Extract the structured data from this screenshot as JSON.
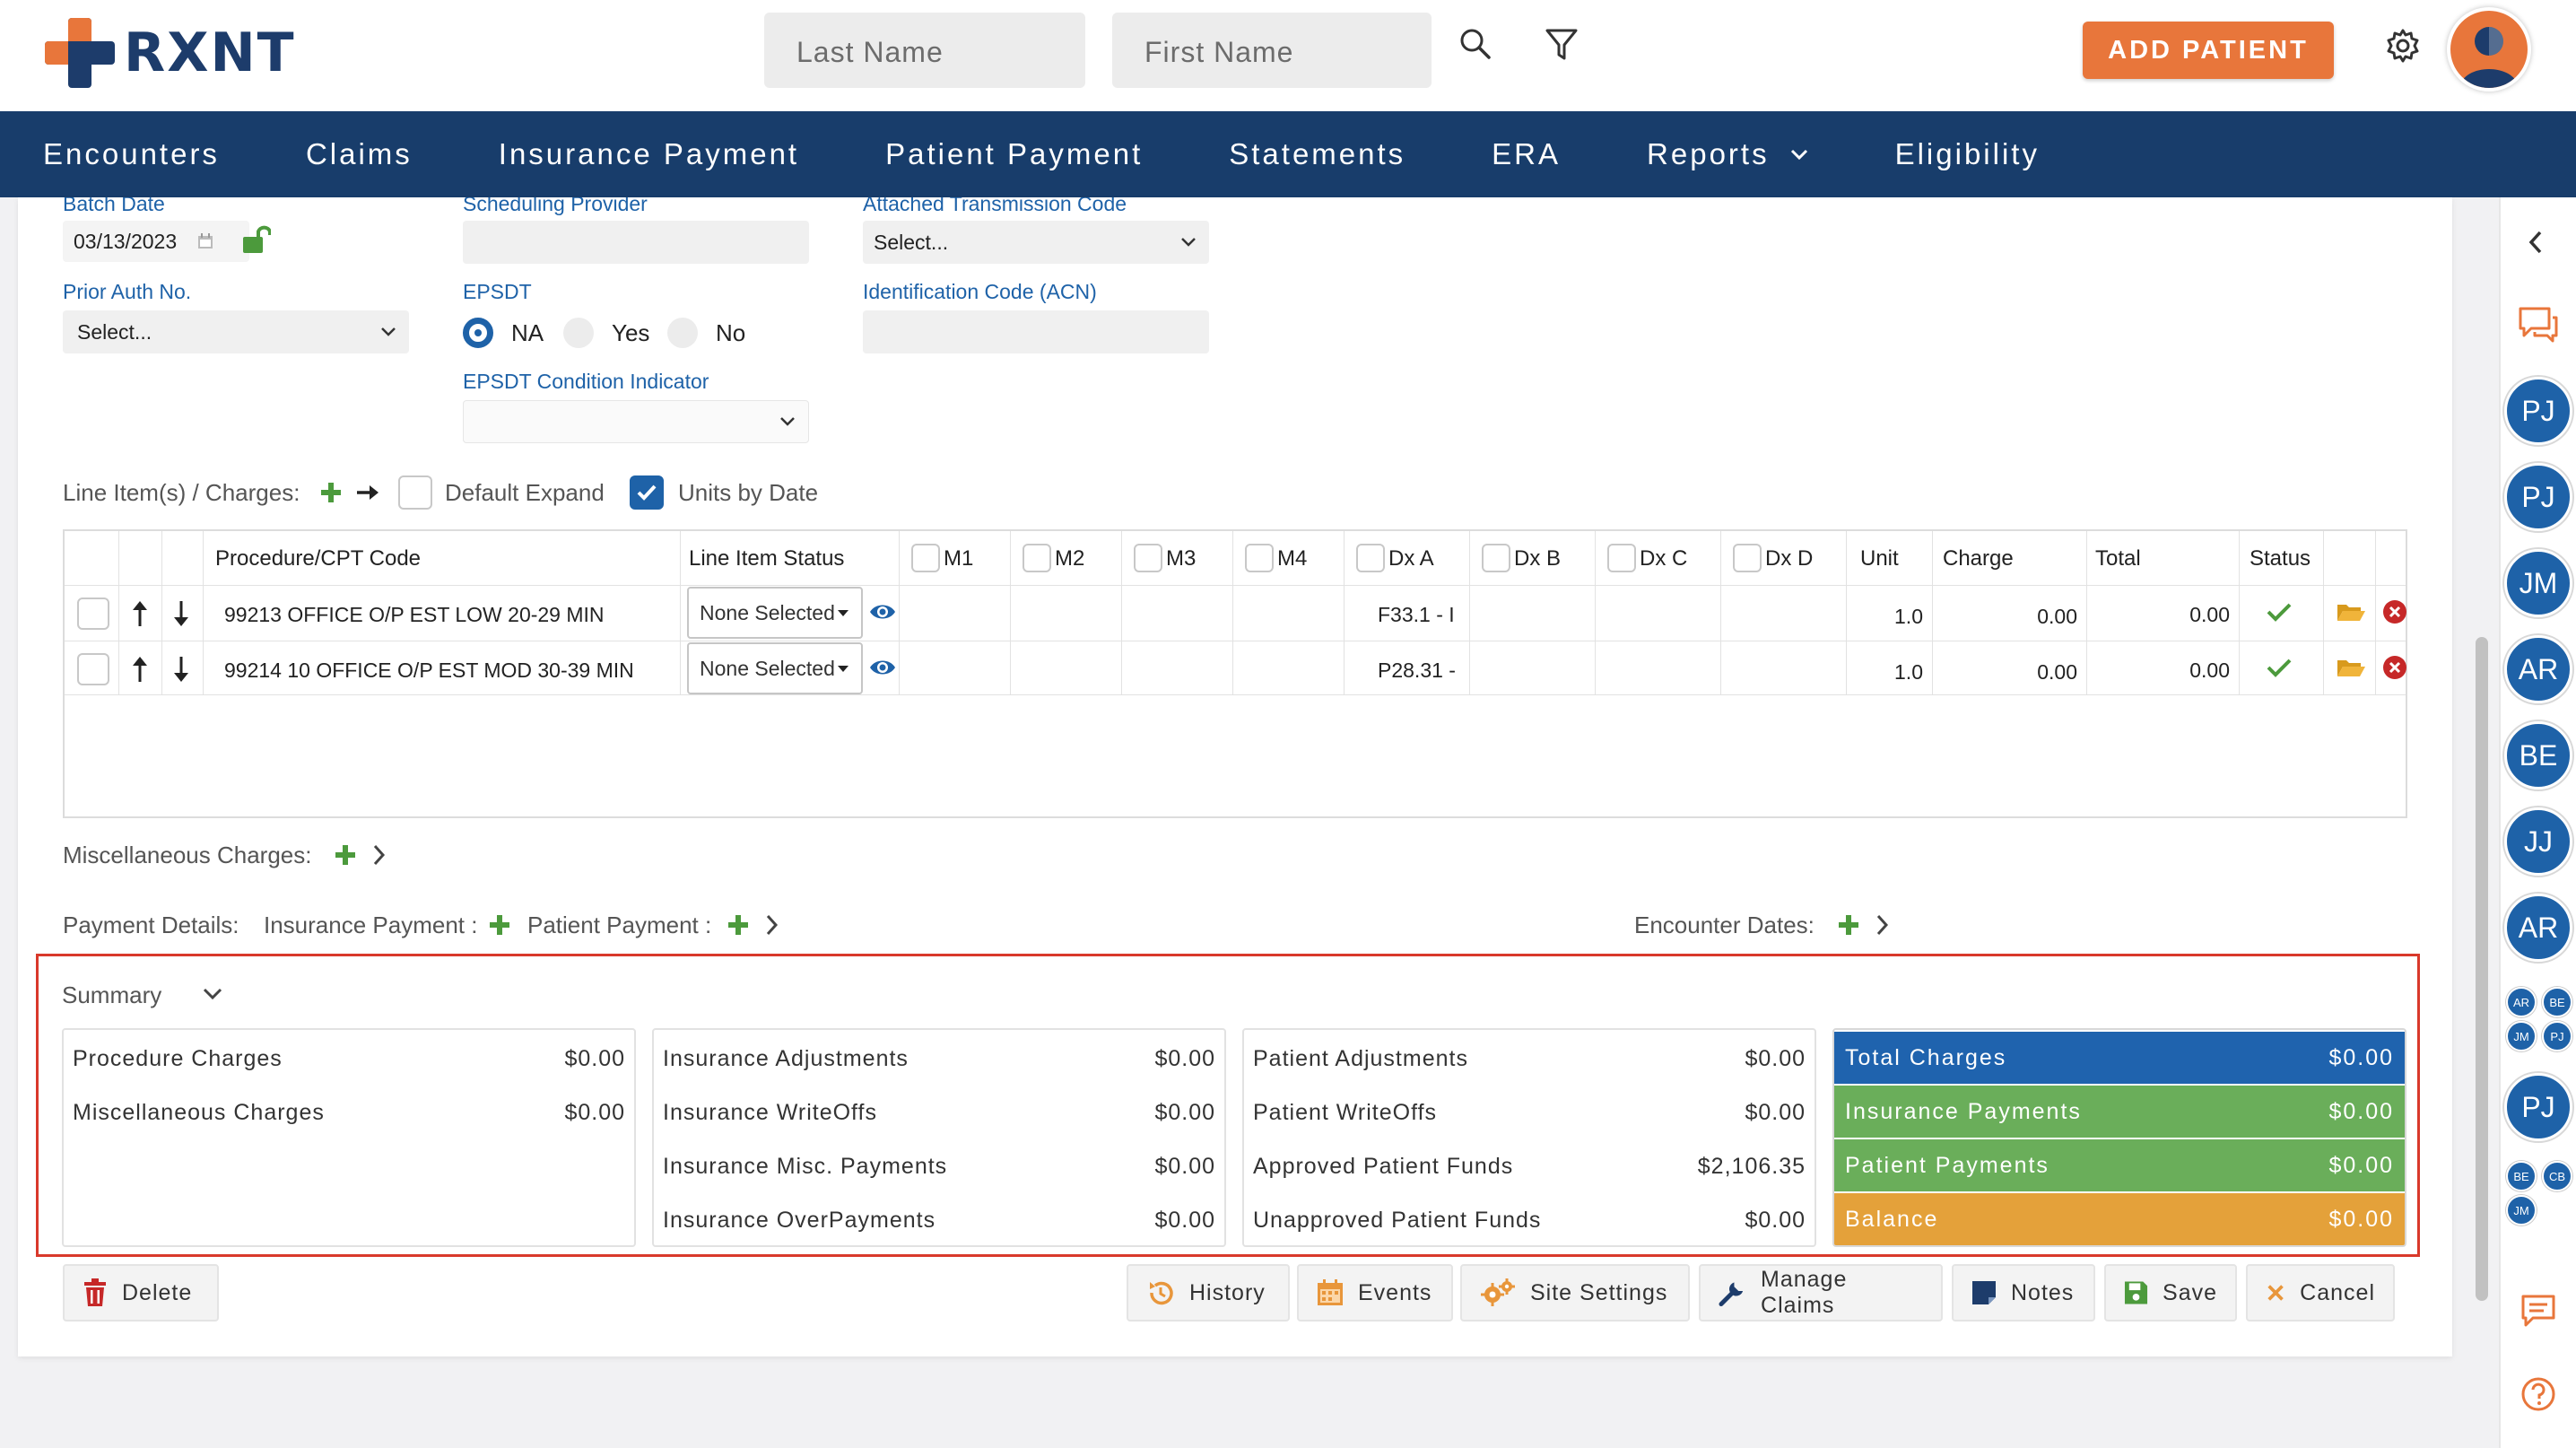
{
  "brand": {
    "name": "RXNT"
  },
  "search": {
    "last_name_placeholder": "Last Name",
    "first_name_placeholder": "First Name"
  },
  "header": {
    "add_patient_label": "ADD PATIENT"
  },
  "nav": {
    "items": [
      "Encounters",
      "Claims",
      "Insurance Payment",
      "Patient Payment",
      "Statements",
      "ERA",
      "Reports",
      "Eligibility"
    ]
  },
  "form": {
    "batch_date_label": "Batch Date",
    "batch_date_value": "03/13/2023",
    "scheduling_provider_label": "Scheduling Provider",
    "attached_transmission_label": "Attached Transmission Code",
    "attached_transmission_value": "Select...",
    "prior_auth_label": "Prior Auth No.",
    "prior_auth_value": "Select...",
    "epsdt_label": "EPSDT",
    "epsdt_options": [
      "NA",
      "Yes",
      "No"
    ],
    "epsdt_selected": "NA",
    "epsdt_condition_label": "EPSDT Condition Indicator",
    "identification_code_label": "Identification Code (ACN)"
  },
  "line_items": {
    "label": "Line Item(s) / Charges:",
    "default_expand_label": "Default Expand",
    "units_by_date_label": "Units by Date",
    "units_by_date_checked": true,
    "columns": [
      "Procedure/CPT Code",
      "Line Item Status",
      "M1",
      "M2",
      "M3",
      "M4",
      "Dx A",
      "Dx B",
      "Dx C",
      "Dx D",
      "Unit",
      "Charge",
      "Total",
      "Status"
    ],
    "rows": [
      {
        "code": "99213 OFFICE O/P EST LOW 20-29 MIN",
        "status": "None Selected",
        "dx_a": "F33.1 - I",
        "unit": "1.0",
        "charge": "0.00",
        "total": "0.00"
      },
      {
        "code": "99214 10 OFFICE O/P EST MOD 30-39 MIN",
        "status": "None Selected",
        "dx_a": "P28.31 -",
        "unit": "1.0",
        "charge": "0.00",
        "total": "0.00"
      }
    ]
  },
  "misc_charges": {
    "label": "Miscellaneous Charges:"
  },
  "payment_details": {
    "label": "Payment Details:",
    "insurance_payment_label": "Insurance Payment :",
    "patient_payment_label": "Patient Payment :",
    "encounter_dates_label": "Encounter Dates:"
  },
  "summary": {
    "title": "Summary",
    "col1": [
      {
        "label": "Procedure Charges",
        "value": "$0.00"
      },
      {
        "label": "Miscellaneous Charges",
        "value": "$0.00"
      }
    ],
    "col2": [
      {
        "label": "Insurance Adjustments",
        "value": "$0.00"
      },
      {
        "label": "Insurance WriteOffs",
        "value": "$0.00"
      },
      {
        "label": "Insurance Misc. Payments",
        "value": "$0.00"
      },
      {
        "label": "Insurance OverPayments",
        "value": "$0.00"
      }
    ],
    "col3": [
      {
        "label": "Patient Adjustments",
        "value": "$0.00"
      },
      {
        "label": "Patient WriteOffs",
        "value": "$0.00"
      },
      {
        "label": "Approved Patient Funds",
        "value": "$2,106.35"
      },
      {
        "label": "Unapproved Patient Funds",
        "value": "$0.00"
      }
    ],
    "totals": [
      {
        "label": "Total Charges",
        "value": "$0.00",
        "color": "#1f63ae"
      },
      {
        "label": "Insurance Payments",
        "value": "$0.00",
        "color": "#6aae5a"
      },
      {
        "label": "Patient Payments",
        "value": "$0.00",
        "color": "#6aae5a"
      },
      {
        "label": "Balance",
        "value": "$0.00",
        "color": "#e4a13a"
      }
    ]
  },
  "actions": {
    "delete": "Delete",
    "history": "History",
    "events": "Events",
    "site_settings": "Site Settings",
    "manage_claims": "Manage Claims",
    "notes": "Notes",
    "save": "Save",
    "cancel": "Cancel"
  },
  "sidebar": {
    "avatars": [
      "PJ",
      "PJ",
      "JM",
      "AR",
      "BE",
      "JJ",
      "AR"
    ],
    "group1": [
      "AR",
      "BE",
      "JM",
      "PJ"
    ],
    "avatar_after": "PJ",
    "group2": [
      "BE",
      "CB",
      "JM"
    ]
  },
  "colors": {
    "brand": "#183d6b",
    "accent": "#e8763b",
    "link": "#1e62a8",
    "success": "#4c9a3c",
    "danger": "#c62828"
  }
}
